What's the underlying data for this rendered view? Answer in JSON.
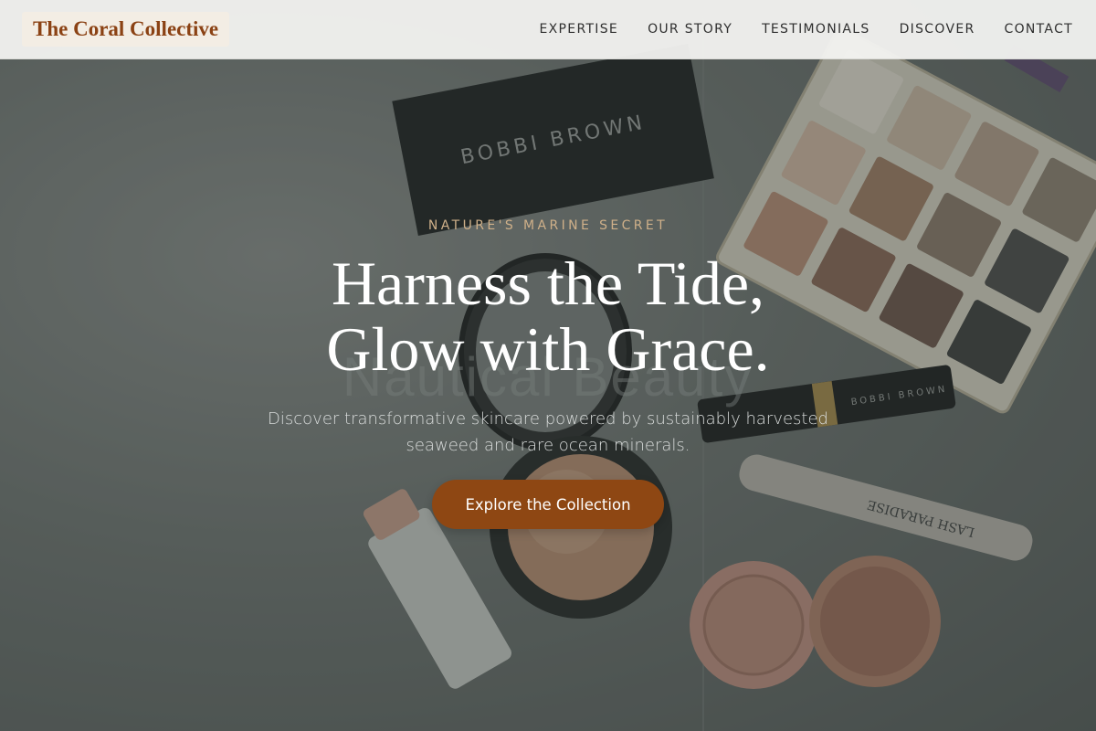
{
  "brand": {
    "name": "The Coral Collective"
  },
  "nav": {
    "items": [
      {
        "label": "EXPERTISE"
      },
      {
        "label": "OUR STORY"
      },
      {
        "label": "TESTIMONIALS"
      },
      {
        "label": "DISCOVER"
      },
      {
        "label": "CONTACT"
      }
    ]
  },
  "hero": {
    "eyebrow": "NATURE'S MARINE SECRET",
    "headline_line1": "Harness the Tide,",
    "headline_line2": "Glow with Grace.",
    "ghost_text": "Nautical Beauty",
    "subtitle": "Discover transformative skincare powered by sustainably harvested seaweed and rare ocean minerals.",
    "cta_label": "Explore the Collection",
    "compact_brand": "BOBBI BROWN",
    "mascara_brand": "LASH PARADISE"
  },
  "colors": {
    "accent": "#8e4713",
    "brand_text": "#8b4214",
    "eyebrow": "#cfb089"
  }
}
